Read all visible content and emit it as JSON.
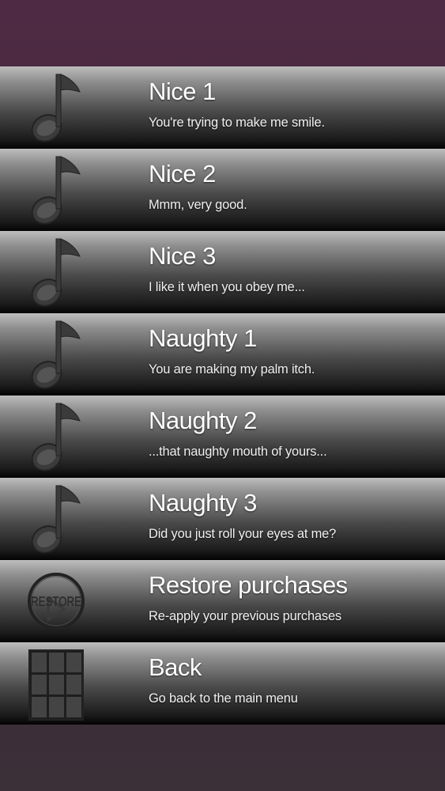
{
  "menu": {
    "items": [
      {
        "title": "Nice 1",
        "subtitle": "You're trying to make me smile.",
        "icon": "music-note-icon"
      },
      {
        "title": "Nice 2",
        "subtitle": "Mmm, very good.",
        "icon": "music-note-icon"
      },
      {
        "title": "Nice 3",
        "subtitle": "I like it when you obey me...",
        "icon": "music-note-icon"
      },
      {
        "title": "Naughty 1",
        "subtitle": "You are making my palm itch.",
        "icon": "music-note-icon"
      },
      {
        "title": "Naughty 2",
        "subtitle": "...that naughty mouth of yours...",
        "icon": "music-note-icon"
      },
      {
        "title": "Naughty 3",
        "subtitle": "Did you just roll your eyes at me?",
        "icon": "music-note-icon"
      },
      {
        "title": "Restore purchases",
        "subtitle": "Re-apply your previous purchases",
        "icon": "restore-icon",
        "icon_label": "RESTORE"
      },
      {
        "title": "Back",
        "subtitle": "Go back to the main menu",
        "icon": "grid-menu-icon"
      }
    ]
  },
  "colors": {
    "background": "#4f2a44",
    "icon": "#3a3a3a",
    "text": "#ffffff"
  }
}
